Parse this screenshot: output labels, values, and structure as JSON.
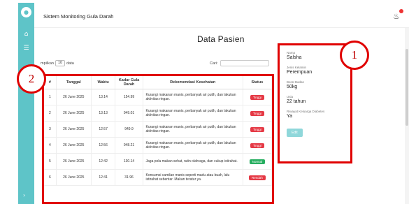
{
  "app": {
    "title": "Sistem Monitoring Gula Darah"
  },
  "icons": {
    "logo": "droplet-icon",
    "nav": [
      "home-icon",
      "list-icon"
    ],
    "bottom": "chevron-icon",
    "notification": "bell-icon"
  },
  "colors": {
    "sidebar": "#5ec4c8",
    "highlight": "#e00000",
    "tinggi": "#e53945",
    "normal": "#27ae60",
    "rendah": "#e53945"
  },
  "page": {
    "title": "Data Pasien"
  },
  "table_controls": {
    "show_prefix": "mpilkan",
    "entries_value": "10",
    "show_suffix": "data",
    "search_label": "Cari:"
  },
  "table": {
    "headers": [
      "#",
      "Tanggal",
      "Waktu",
      "Kadar Gula Darah",
      "Rekomendasi Kesehatan",
      "Status"
    ],
    "rows": [
      {
        "no": "1",
        "tanggal": "26 June 2025",
        "waktu": "13:14",
        "kadar": "154.99",
        "rekomendasi": "Kurangi makanan manis, perbanyak air putih, dan lakukan aktivitas ringan.",
        "status": "Tinggi",
        "status_type": "tinggi"
      },
      {
        "no": "2",
        "tanggal": "26 June 2025",
        "waktu": "13:13",
        "kadar": "949.01",
        "rekomendasi": "Kurangi makanan manis, perbanyak air putih, dan lakukan aktivitas ringan.",
        "status": "Tinggi",
        "status_type": "tinggi"
      },
      {
        "no": "3",
        "tanggal": "26 June 2025",
        "waktu": "12:57",
        "kadar": "949.9",
        "rekomendasi": "Kurangi makanan manis, perbanyak air putih, dan lakukan aktivitas ringan.",
        "status": "Tinggi",
        "status_type": "tinggi"
      },
      {
        "no": "4",
        "tanggal": "26 June 2025",
        "waktu": "12:56",
        "kadar": "948.21",
        "rekomendasi": "Kurangi makanan manis, perbanyak air putih, dan lakukan aktivitas ringan.",
        "status": "Tinggi",
        "status_type": "tinggi"
      },
      {
        "no": "5",
        "tanggal": "26 June 2025",
        "waktu": "12:42",
        "kadar": "130.14",
        "rekomendasi": "Jaga pola makan sehat, rutin olahraga, dan cukup istirahat.",
        "status": "Normal",
        "status_type": "normal"
      },
      {
        "no": "6",
        "tanggal": "26 June 2025",
        "waktu": "12:41",
        "kadar": "31.96",
        "rekomendasi": "Konsumsi camilan manis seperti madu atau buah, lalu istirahat sebentar. Makan teratur ya.",
        "status": "Rendah",
        "status_type": "rendah"
      }
    ]
  },
  "patient": {
    "fields": [
      {
        "label": "Nama",
        "value": "Salsha"
      },
      {
        "label": "Jenis Kelamin",
        "value": "Perempuan"
      },
      {
        "label": "Berat Badan",
        "value": "50kg"
      },
      {
        "label": "Usia",
        "value": "22 tahun"
      },
      {
        "label": "Riwayat Keluarga Diabetes",
        "value": "Ya"
      }
    ],
    "edit_label": "Edit"
  },
  "callouts": {
    "one": "1",
    "two": "2"
  }
}
